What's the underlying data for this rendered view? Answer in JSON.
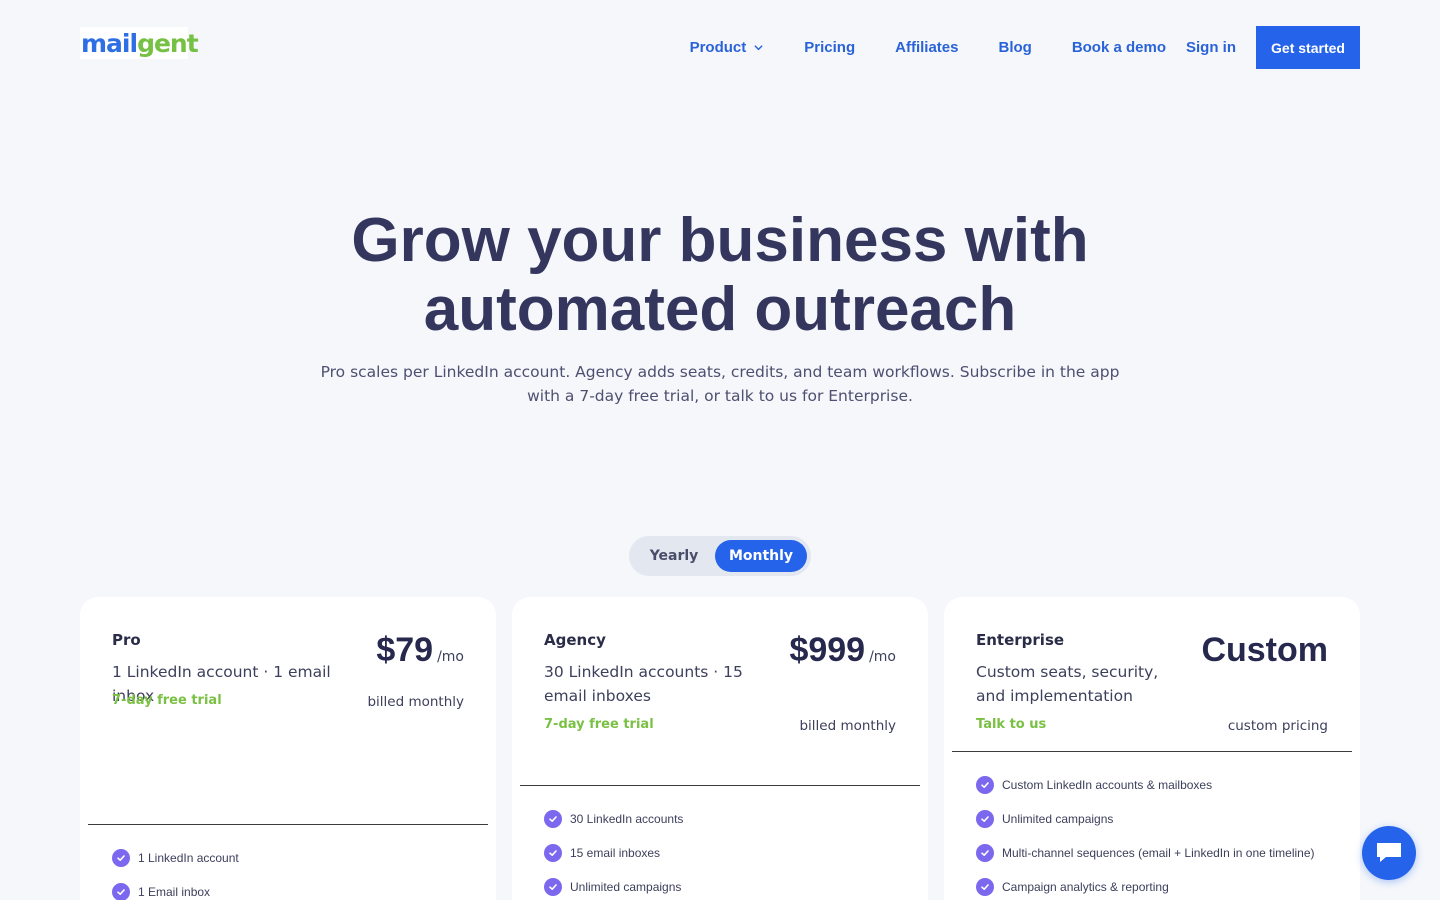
{
  "brand": {
    "logo_part1": "mail",
    "logo_part2": "gent"
  },
  "nav": {
    "items": [
      {
        "label": "Product",
        "icon": "chevron-down-icon"
      },
      {
        "label": "Pricing"
      },
      {
        "label": "Affiliates"
      },
      {
        "label": "Blog"
      },
      {
        "label": "Book a demo"
      },
      {
        "label": "Sign in"
      }
    ],
    "cta_label": "Get started"
  },
  "hero": {
    "title_line1": "Grow your business with",
    "title_line2": "automated outreach",
    "subtitle_line1": "Pro scales per LinkedIn account. Agency adds seats, credits, and team workflows. Subscribe in the app",
    "subtitle_line2": "with a 7-day free trial, or talk to us for Enterprise."
  },
  "billing_toggle": {
    "options": [
      "Yearly",
      "Monthly"
    ],
    "selected": "Monthly"
  },
  "plans": [
    {
      "name": "Pro",
      "description": "1 LinkedIn account · 1 email inbox",
      "note": "7-day free trial",
      "price": "$79",
      "period": "/mo",
      "billing": "billed monthly",
      "features": [
        "1 LinkedIn account",
        "1 Email inbox"
      ]
    },
    {
      "name": "Agency",
      "description": "30 LinkedIn accounts · 15 email inboxes",
      "note": "7-day free trial",
      "price": "$999",
      "period": "/mo",
      "billing": "billed monthly",
      "features": [
        "30 LinkedIn accounts",
        "15 email inboxes",
        "Unlimited campaigns"
      ]
    },
    {
      "name": "Enterprise",
      "description": "Custom seats, security, and implementation",
      "note": "Talk to us",
      "price": "Custom",
      "period": "",
      "billing": "custom pricing",
      "features": [
        "Custom LinkedIn accounts & mailboxes",
        "Unlimited campaigns",
        "Multi-channel sequences (email + LinkedIn in one timeline)",
        "Campaign analytics & reporting"
      ]
    }
  ],
  "colors": {
    "accent": "#2563eb",
    "nav_link": "#2a63d8",
    "trial_green": "#7ac143",
    "check_purple": "#7b68ee",
    "heading": "#34365e",
    "background": "#f5f7fb"
  },
  "chat": {
    "icon": "chat-icon"
  }
}
